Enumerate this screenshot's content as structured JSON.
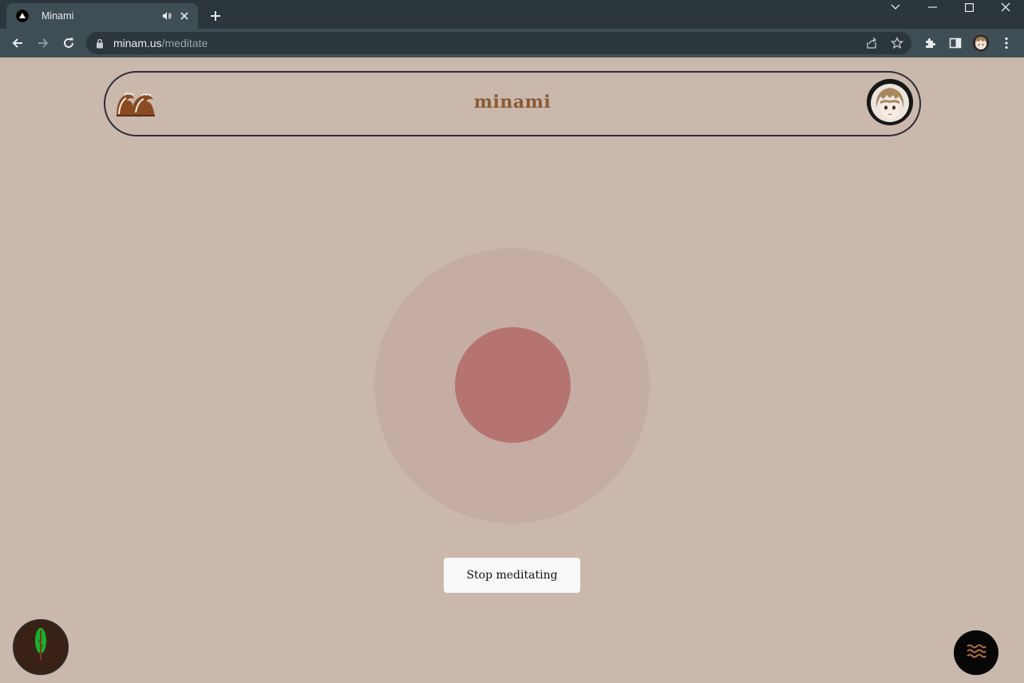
{
  "browser": {
    "tab_title": "Minami",
    "url_host": "minam.us",
    "url_path": "/meditate"
  },
  "header": {
    "brand": "minami",
    "logo_icon": "great-wave-icon",
    "avatar_icon": "anime-avatar-icon"
  },
  "meditation": {
    "outer_color": "#c5ada3",
    "inner_color": "#b5746f",
    "stop_label": "Stop meditating"
  },
  "floating": {
    "left_icon": "tree-icon",
    "right_icon": "waves-icon"
  },
  "colors": {
    "background": "#c9b8ab",
    "brand_text": "#8a5a36"
  }
}
